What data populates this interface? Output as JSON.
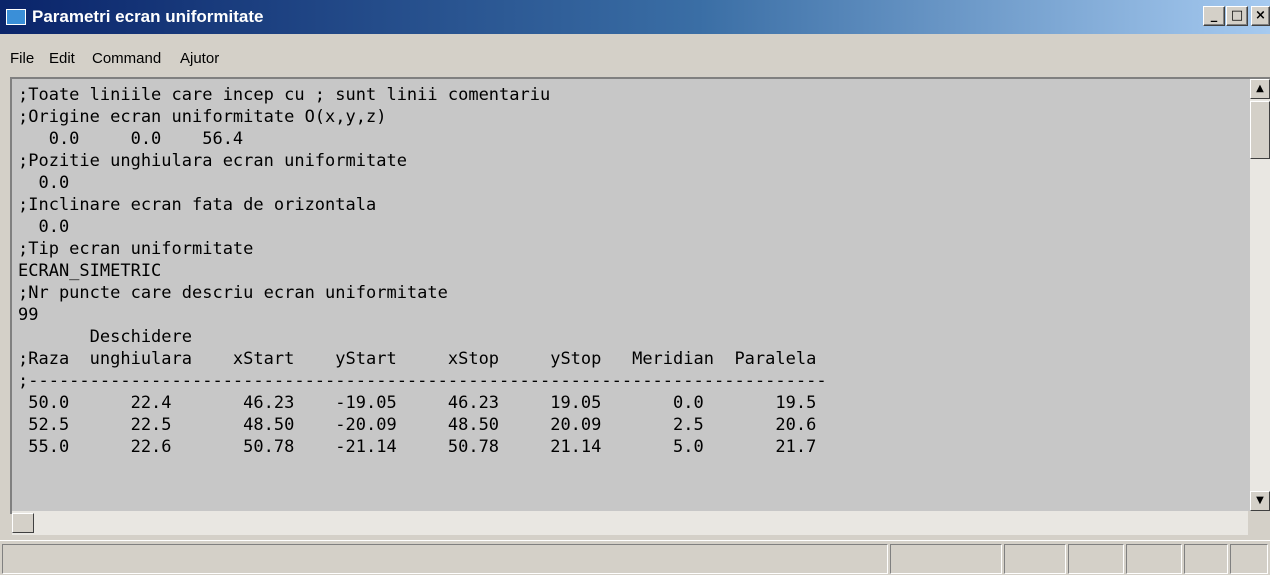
{
  "window": {
    "title": "Parametri ecran uniformitate",
    "controls": {
      "minimize": "_",
      "maximize": "□",
      "close": "×"
    }
  },
  "menu": [
    "File",
    "Edit",
    "Command",
    "Ajutor"
  ],
  "editor": {
    "lines": [
      ";Toate liniile care incep cu ; sunt linii comentariu",
      ";Origine ecran uniformitate O(x,y,z)",
      "   0.0     0.0    56.4",
      ";Pozitie unghiulara ecran uniformitate",
      "  0.0",
      ";Inclinare ecran fata de orizontala",
      "  0.0",
      ";Tip ecran uniformitate",
      "ECRAN_SIMETRIC",
      ";Nr puncte care descriu ecran uniformitate",
      "99",
      "       Deschidere",
      ";Raza  unghiulara    xStart    yStart     xStop     yStop   Meridian  Paralela",
      ";------------------------------------------------------------------------------",
      " 50.0      22.4       46.23    -19.05     46.23     19.05       0.0       19.5",
      " 52.5      22.5       48.50    -20.09     48.50     20.09       2.5       20.6",
      " 55.0      22.6       50.78    -21.14     50.78     21.14       5.0       21.7"
    ]
  },
  "scroll": {
    "up_arrow": "▲",
    "down_arrow": "▼"
  },
  "icons": {
    "app": "window-icon",
    "up": "arrow-up-icon",
    "down": "arrow-down-icon"
  }
}
